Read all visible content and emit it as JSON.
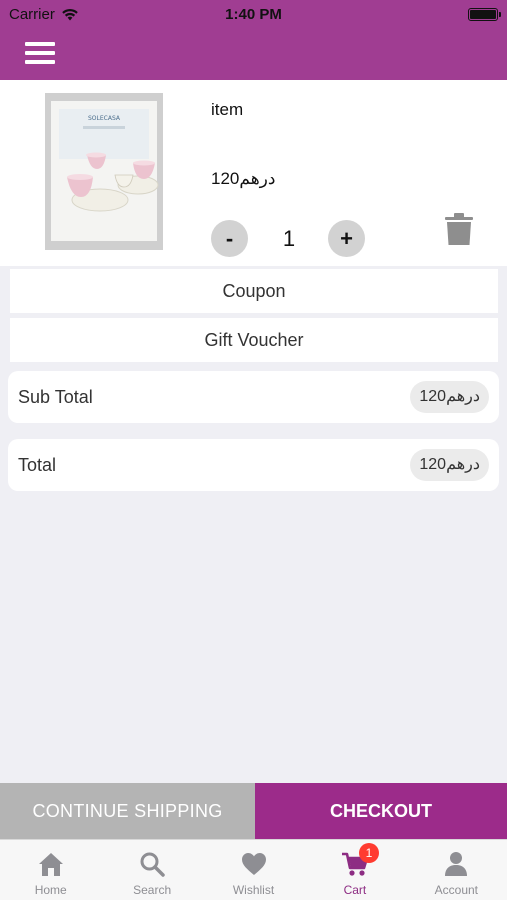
{
  "status_bar": {
    "carrier": "Carrier",
    "time": "1:40 PM"
  },
  "cart_item": {
    "name": "item",
    "price": "120درهم",
    "quantity": "1",
    "minus_label": "-",
    "plus_label": "+",
    "image_text": "SOLECASA"
  },
  "coupon": {
    "label": "Coupon"
  },
  "voucher": {
    "label": "Gift Voucher"
  },
  "sub_total": {
    "label": "Sub Total",
    "amount": "120درهم"
  },
  "total": {
    "label": "Total",
    "amount": "120درهم"
  },
  "actions": {
    "continue_label": "CONTINUE SHIPPING",
    "checkout_label": "CHECKOUT"
  },
  "tabs": [
    {
      "label": "Home",
      "icon": "home-icon"
    },
    {
      "label": "Search",
      "icon": "search-icon"
    },
    {
      "label": "Wishlist",
      "icon": "heart-icon"
    },
    {
      "label": "Cart",
      "icon": "cart-icon",
      "badge": "1",
      "active": true
    },
    {
      "label": "Account",
      "icon": "account-icon"
    }
  ],
  "colors": {
    "header": "#a03d92",
    "checkout": "#9c2b8a",
    "continue": "#b4b4b4",
    "active_tab": "#8d2d83",
    "inactive_tab": "#8e8e93",
    "badge": "#ff3b30",
    "background": "#efeff4"
  }
}
